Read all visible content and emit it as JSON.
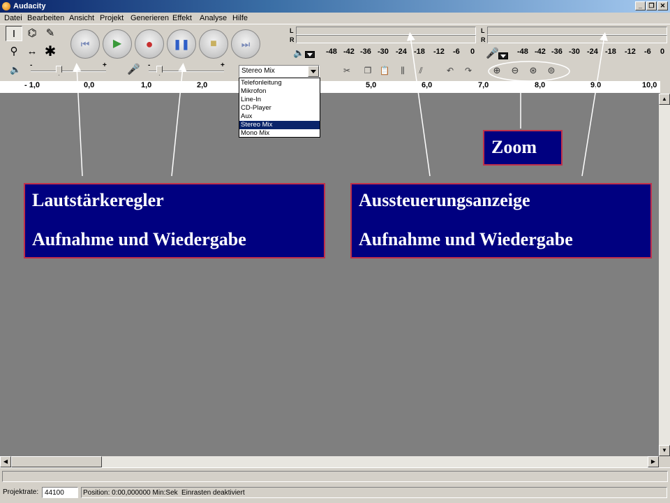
{
  "window": {
    "title": "Audacity",
    "btn_minimize": "_",
    "btn_restore": "❐",
    "btn_close": "✕"
  },
  "menu": [
    "Datei",
    "Bearbeiten",
    "Ansicht",
    "Projekt",
    "Generieren",
    "Effekt",
    "Analyse",
    "Hilfe"
  ],
  "meters": {
    "left_label": "L",
    "right_label": "R",
    "scale": [
      "-48",
      "-42",
      "-36",
      "-30",
      "-24",
      "-18",
      "-12",
      "-6",
      "0"
    ]
  },
  "volume": {
    "minus": "-",
    "plus": "+"
  },
  "input_source": {
    "selected": "Stereo Mix",
    "options": [
      "Telefonleitung",
      "Mikrofon",
      "Line-In",
      "CD-Player",
      "Aux",
      "Stereo Mix",
      "Mono Mix"
    ],
    "selected_index": 5
  },
  "ruler": [
    "- 1,0",
    "0,0",
    "1,0",
    "2,0",
    "5,0",
    "6,0",
    "7,0",
    "8,0",
    "9,0",
    "10,0"
  ],
  "status": {
    "rate_label": "Projektrate:",
    "rate_value": "44100",
    "position_text": "Position: 0:00,000000 Min:Sek",
    "snap_text": "Einrasten deaktiviert"
  },
  "callouts": {
    "zoom": "Zoom",
    "volume_line1": "Lautstärkeregler",
    "volume_line2": "Aufnahme und Wiedergabe",
    "meter_line1": "Aussteuerungsanzeige",
    "meter_line2": "Aufnahme und Wiedergabe"
  },
  "colors": {
    "callout_bg": "#000080",
    "callout_border": "#c0304a",
    "track_bg": "#7f7f7f",
    "selection": "#0a246a"
  }
}
